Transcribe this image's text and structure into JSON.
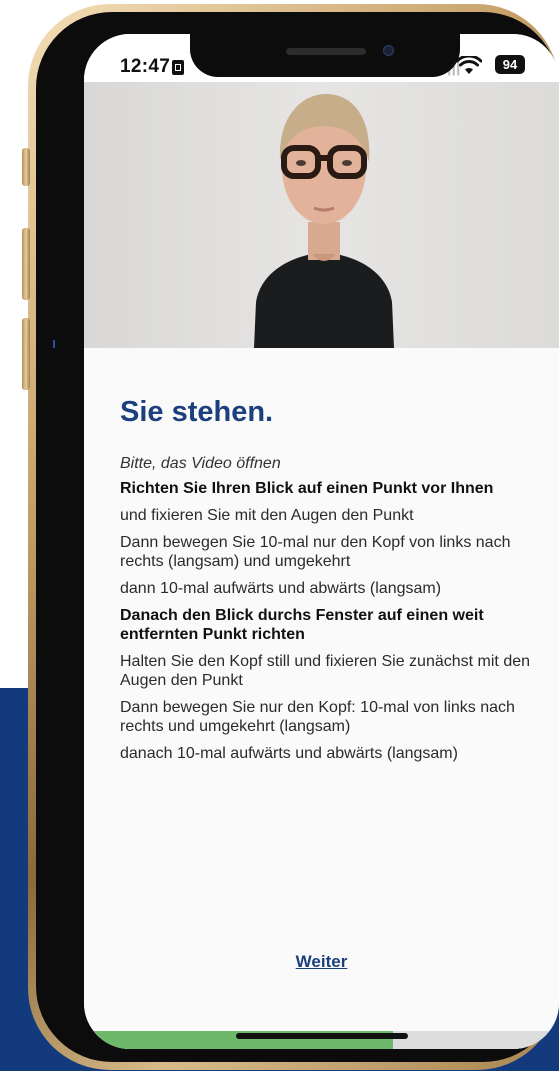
{
  "status_bar": {
    "time": "12:47",
    "battery": "94",
    "sim_icon": "sim-card-icon",
    "wifi_icon": "wifi-icon",
    "signal_icon": "signal-icon"
  },
  "video": {
    "icon": "video-player"
  },
  "content": {
    "title": "Sie stehen.",
    "paragraphs": [
      "Bitte, das Video öffnen",
      "Richten Sie Ihren Blick auf einen Punkt vor Ihnen",
      "und fixieren Sie mit den Augen den  Punkt",
      "Dann bewegen Sie 10-mal nur den Kopf von links nach rechts (langsam) und umgekehrt",
      "dann 10-mal aufwärts und abwärts (langsam)",
      "Danach den Blick durchs Fenster auf einen weit entfernten Punkt richten",
      "Halten Sie den Kopf still und fixieren Sie zunächst mit den Augen den Punkt",
      "Dann bewegen Sie nur den Kopf: 10-mal von links nach rechts und umgekehrt (langsam)",
      "danach 10-mal aufwärts und abwärts (langsam)"
    ],
    "next_label": "Weiter"
  },
  "progress": {
    "fraction": 0.65,
    "color": "#6db86b"
  },
  "colors": {
    "accent": "#1c3f7e",
    "background_band": "#143a7e"
  }
}
